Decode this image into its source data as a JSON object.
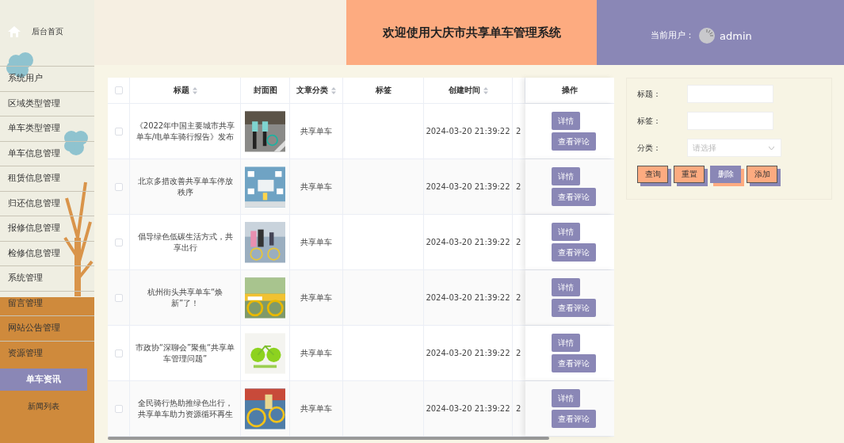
{
  "sidebar": {
    "home": {
      "label": "后台首页"
    },
    "items": [
      {
        "label": "系统用户"
      },
      {
        "label": "区域类型管理"
      },
      {
        "label": "单车类型管理"
      },
      {
        "label": "单车信息管理"
      },
      {
        "label": "租赁信息管理"
      },
      {
        "label": "归还信息管理"
      },
      {
        "label": "报修信息管理"
      },
      {
        "label": "检修信息管理"
      },
      {
        "label": "系统管理"
      },
      {
        "label": "留言管理"
      },
      {
        "label": "网站公告管理"
      },
      {
        "label": "资源管理"
      }
    ],
    "section": {
      "label": "单车资讯",
      "selected": true
    },
    "subitems": [
      {
        "label": "新闻列表",
        "selected": false
      }
    ]
  },
  "header": {
    "title": "欢迎使用大庆市共享单车管理系统",
    "user_label": "当前用户：",
    "username": "admin"
  },
  "table": {
    "columns": [
      {
        "kind": "check",
        "checked": false
      },
      {
        "kind": "text",
        "label": "标题",
        "sortable": true
      },
      {
        "kind": "text",
        "label": "封面图",
        "sortable": false
      },
      {
        "kind": "text",
        "label": "文章分类",
        "sortable": true
      },
      {
        "kind": "text",
        "label": "标签",
        "sortable": false
      },
      {
        "kind": "text",
        "label": "创建时间",
        "sortable": true
      },
      {
        "kind": "blank"
      },
      {
        "kind": "text",
        "label": "操作",
        "sortable": false
      }
    ],
    "rows": [
      {
        "checked": false,
        "title": "《2022年中国主要城市共享单车/电单车骑行报告》发布",
        "category": "共享单车",
        "created": "2024-03-20 21:39:22",
        "column_7": "2",
        "actions": [
          "详情",
          "查看评论"
        ]
      },
      {
        "checked": false,
        "title": "北京多措改善共享单车停放秩序",
        "category": "共享单车",
        "created": "2024-03-20 21:39:22",
        "column_7": "2",
        "actions": [
          "详情",
          "查看评论"
        ]
      },
      {
        "checked": false,
        "title": "倡导绿色低碳生活方式，共享出行",
        "category": "共享单车",
        "created": "2024-03-20 21:39:22",
        "column_7": "2",
        "actions": [
          "详情",
          "查看评论"
        ]
      },
      {
        "checked": false,
        "title": "杭州街头共享单车“焕新”了！",
        "category": "共享单车",
        "created": "2024-03-20 21:39:22",
        "column_7": "2",
        "actions": [
          "详情",
          "查看评论"
        ]
      },
      {
        "checked": false,
        "title": "市政协“深聊会”聚焦“共享单车管理问题”",
        "category": "共享单车",
        "created": "2024-03-20 21:39:22",
        "column_7": "2",
        "actions": [
          "详情",
          "查看评论"
        ]
      },
      {
        "checked": false,
        "title": "全民骑行热助推绿色出行，共享单车助力资源循环再生",
        "category": "共享单车",
        "created": "2024-03-20 21:39:22",
        "column_7": "2",
        "actions": [
          "详情",
          "查看评论"
        ]
      }
    ]
  },
  "search": {
    "fields": [
      {
        "kind": "text",
        "label": "标题："
      },
      {
        "kind": "text",
        "label": "标签："
      },
      {
        "kind": "select",
        "label": "分类：",
        "placeholder": "请选择"
      }
    ],
    "buttons": [
      {
        "label": "查询",
        "highlighted": false
      },
      {
        "label": "重置",
        "highlighted": false
      },
      {
        "label": "删除",
        "highlighted": true
      },
      {
        "label": "添加",
        "highlighted": false
      }
    ]
  }
}
